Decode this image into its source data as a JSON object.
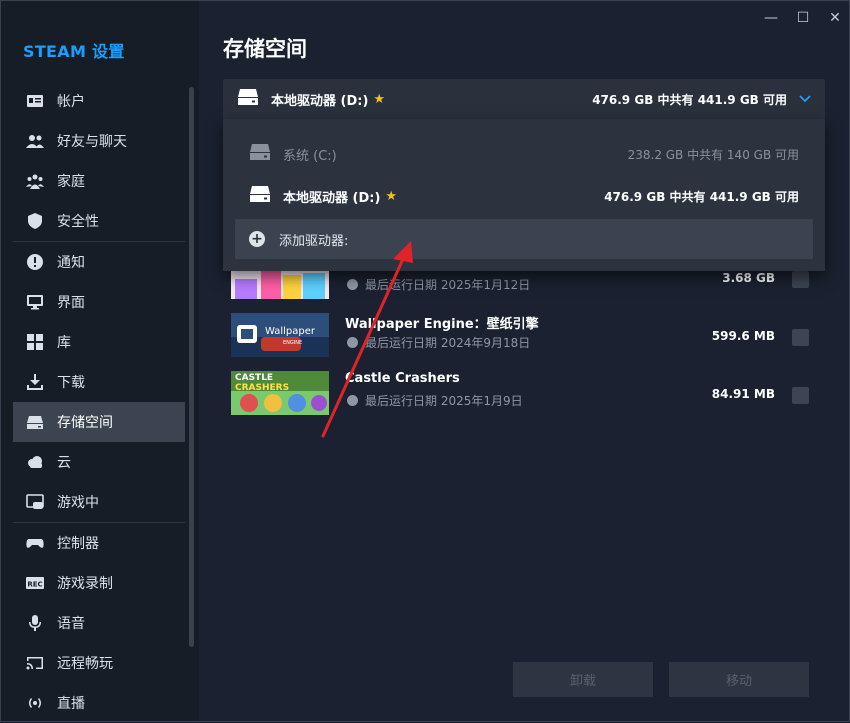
{
  "app": {
    "title": "STEAM 设置"
  },
  "window_controls": {
    "minimize": "—",
    "maximize": "☐",
    "close": "✕"
  },
  "sidebar": {
    "items": [
      {
        "label": "帐户",
        "icon": "account-card-icon"
      },
      {
        "label": "好友与聊天",
        "icon": "friends-icon"
      },
      {
        "label": "家庭",
        "icon": "family-icon"
      },
      {
        "label": "安全性",
        "icon": "shield-icon"
      },
      {
        "label": "通知",
        "icon": "notification-icon"
      },
      {
        "label": "界面",
        "icon": "monitor-icon"
      },
      {
        "label": "库",
        "icon": "grid-icon"
      },
      {
        "label": "下载",
        "icon": "download-icon"
      },
      {
        "label": "存储空间",
        "icon": "drive-icon",
        "active": true
      },
      {
        "label": "云",
        "icon": "cloud-icon"
      },
      {
        "label": "游戏中",
        "icon": "in-game-icon"
      },
      {
        "label": "控制器",
        "icon": "controller-icon"
      },
      {
        "label": "游戏录制",
        "icon": "rec-icon"
      },
      {
        "label": "语音",
        "icon": "microphone-icon"
      },
      {
        "label": "远程畅玩",
        "icon": "cast-icon"
      },
      {
        "label": "直播",
        "icon": "broadcast-icon"
      }
    ]
  },
  "main": {
    "title": "存储空间",
    "drive_selector": {
      "name": "本地驱动器 (D:)",
      "space": "476.9 GB 中共有 441.9 GB 可用"
    },
    "dropdown": {
      "options": [
        {
          "name": "系统 (C:)",
          "space": "238.2 GB 中共有 140 GB 可用"
        },
        {
          "name": "本地驱动器 (D:)",
          "space": "476.9 GB 中共有 441.9 GB 可用"
        }
      ],
      "add_label": "添加驱动器:"
    },
    "games": [
      {
        "name": "",
        "date": "最后运行日期 2025年1月12日",
        "size": "3.68 GB"
      },
      {
        "name": "Wallpaper Engine：壁纸引擎",
        "thumb_text": "Wallpaper",
        "thumb_sub": "ENGINE",
        "date": "最后运行日期 2024年9月18日",
        "size": "599.6 MB"
      },
      {
        "name": "Castle Crashers",
        "thumb_text": "CASTLE",
        "thumb_sub": "CRASHERS",
        "date": "最后运行日期 2025年1月9日",
        "size": "84.91 MB"
      }
    ],
    "buttons": {
      "uninstall": "卸载",
      "move": "移动"
    }
  },
  "colors": {
    "accent": "#1a9fff",
    "star": "#f2c21b",
    "annotation_arrow": "#e0232a"
  }
}
